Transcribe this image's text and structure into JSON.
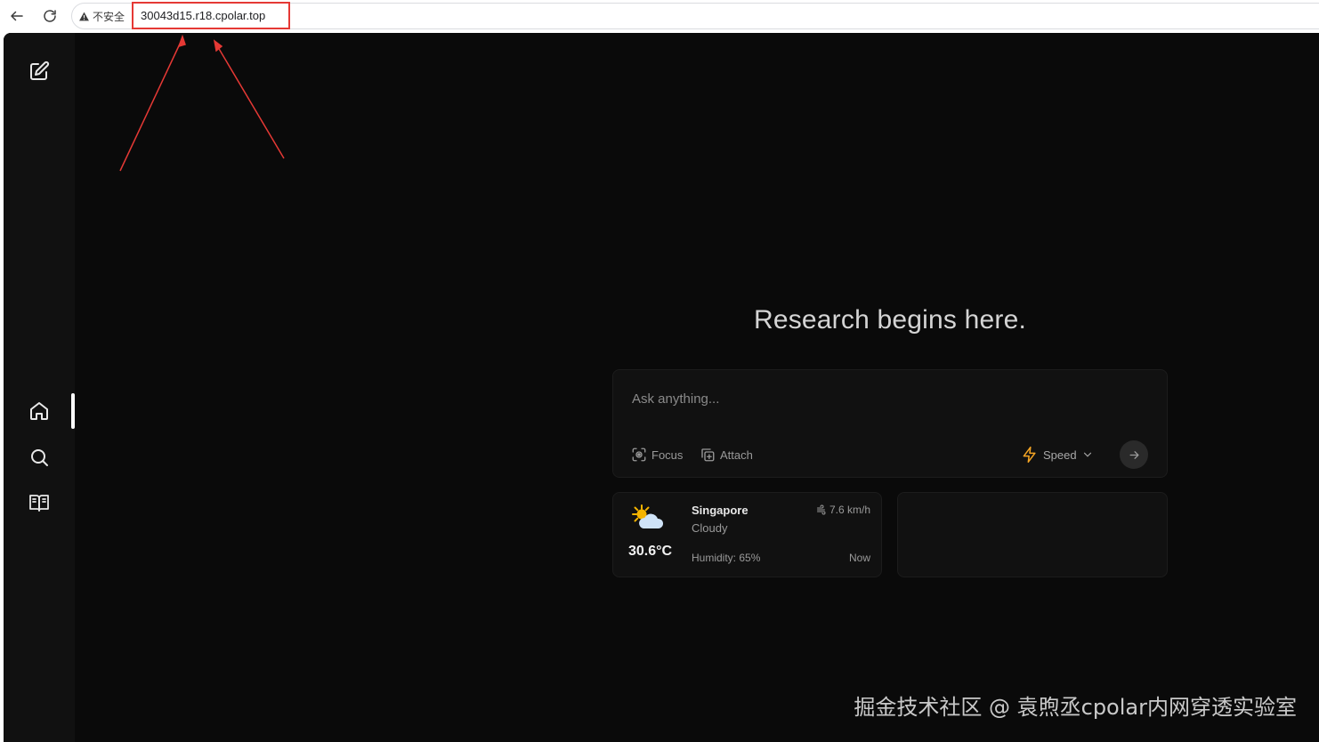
{
  "browser": {
    "security_label": "不安全",
    "url": "30043d15.r18.cpolar.top",
    "highlight_color": "#e53935"
  },
  "sidebar": {
    "items": [
      {
        "icon": "new-chat-icon"
      },
      {
        "icon": "home-icon",
        "active": true
      },
      {
        "icon": "search-icon"
      },
      {
        "icon": "library-icon"
      }
    ]
  },
  "main": {
    "title": "Research begins here.",
    "search": {
      "placeholder": "Ask anything...",
      "focus_label": "Focus",
      "attach_label": "Attach",
      "mode_label": "Speed",
      "mode_icon_color": "#f5a524"
    },
    "weather": {
      "city": "Singapore",
      "condition": "Cloudy",
      "temperature": "30.6°C",
      "wind": "7.6 km/h",
      "humidity": "Humidity: 65%",
      "time": "Now"
    }
  },
  "watermark": "掘金技术社区 @ 袁煦丞cpolar内网穿透实验室"
}
